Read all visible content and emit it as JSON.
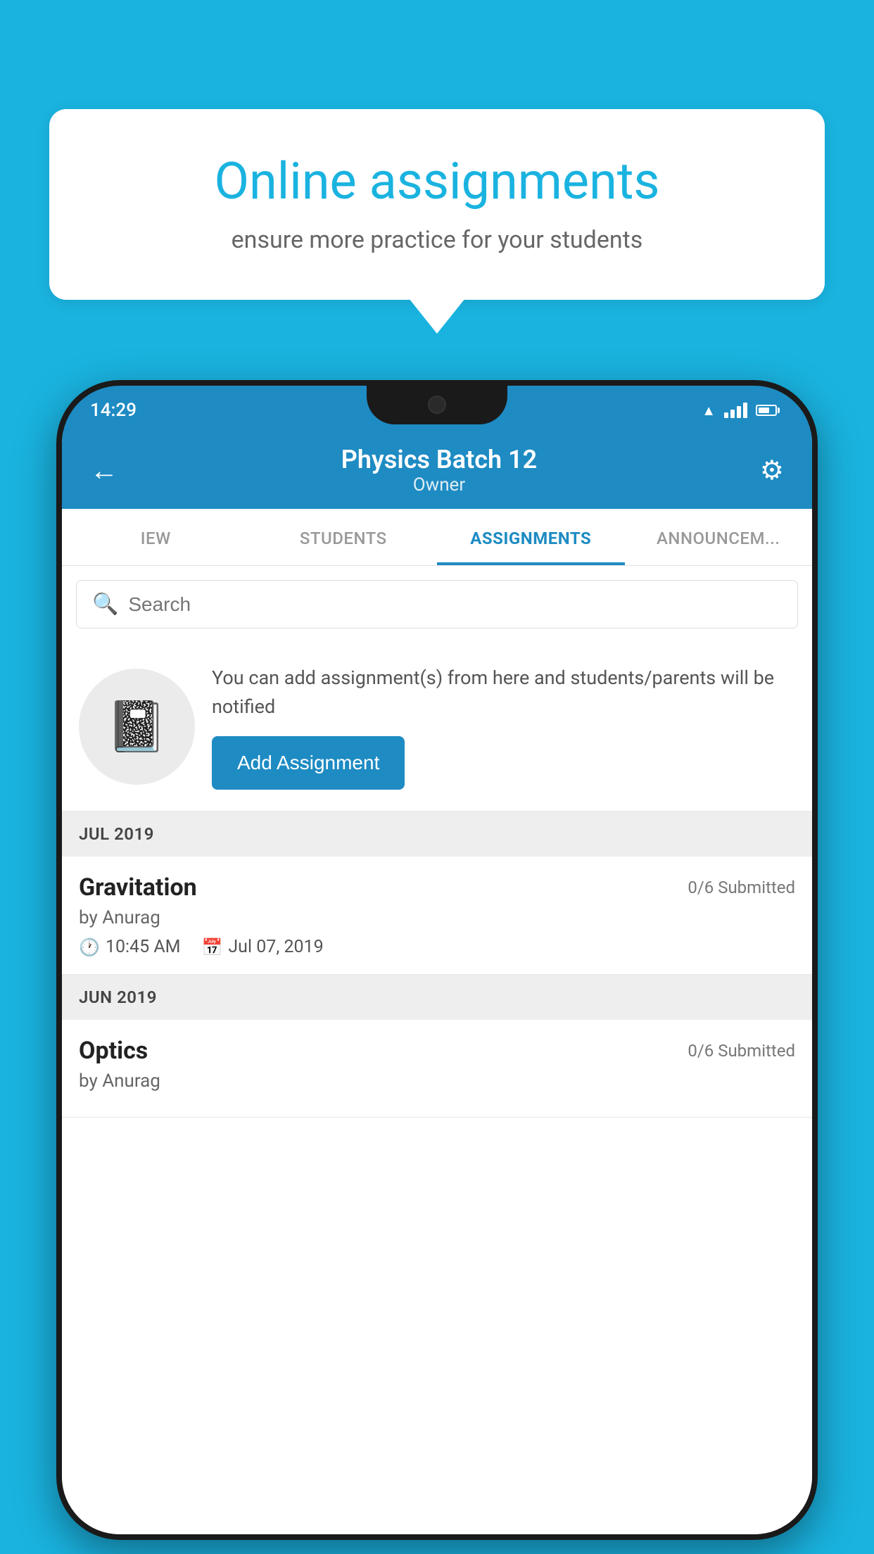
{
  "background_color": "#1ab3e0",
  "speech_bubble": {
    "title": "Online assignments",
    "subtitle": "ensure more practice for your students"
  },
  "status_bar": {
    "time": "14:29"
  },
  "app_bar": {
    "title": "Physics Batch 12",
    "subtitle": "Owner",
    "back_label": "←",
    "settings_label": "⚙"
  },
  "tabs": [
    {
      "label": "IEW",
      "active": false
    },
    {
      "label": "STUDENTS",
      "active": false
    },
    {
      "label": "ASSIGNMENTS",
      "active": true
    },
    {
      "label": "ANNOUNCEM...",
      "active": false
    }
  ],
  "search": {
    "placeholder": "Search"
  },
  "promo": {
    "text": "You can add assignment(s) from here and students/parents will be notified",
    "button_label": "Add Assignment"
  },
  "months": [
    {
      "label": "JUL 2019",
      "assignments": [
        {
          "name": "Gravitation",
          "submitted": "0/6 Submitted",
          "author": "by Anurag",
          "time": "10:45 AM",
          "date": "Jul 07, 2019"
        }
      ]
    },
    {
      "label": "JUN 2019",
      "assignments": [
        {
          "name": "Optics",
          "submitted": "0/6 Submitted",
          "author": "by Anurag",
          "time": "",
          "date": ""
        }
      ]
    }
  ]
}
